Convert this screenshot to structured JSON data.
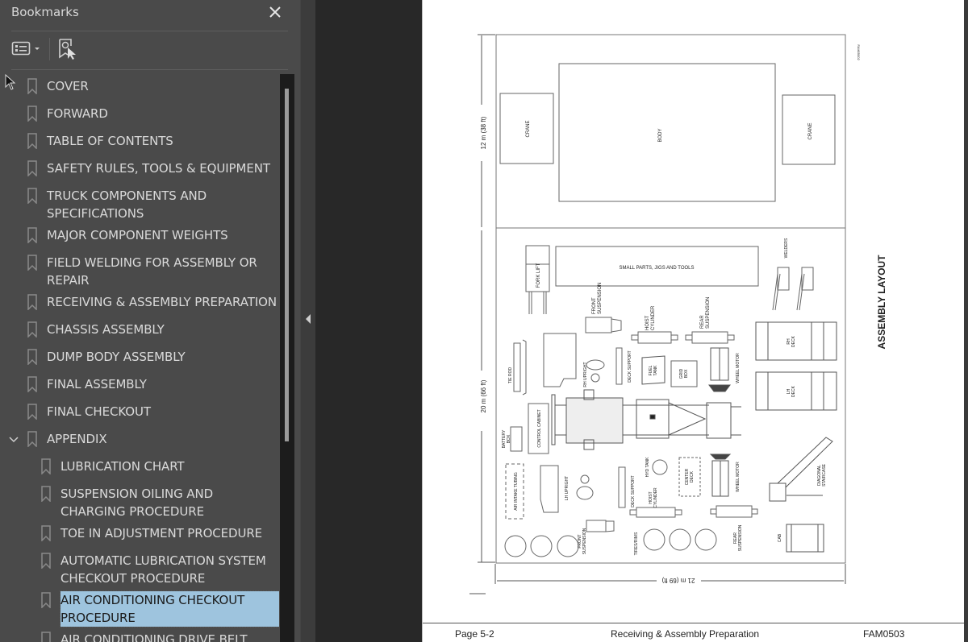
{
  "sidebar": {
    "title": "Bookmarks",
    "close_icon": "close-icon",
    "toolbar": {
      "options_icon": "list-options-icon",
      "options_dropdown_icon": "caret-down-icon",
      "find_bookmark_icon": "bookmark-search-icon"
    },
    "items": [
      {
        "label": "COVER",
        "level": 0
      },
      {
        "label": "FORWARD",
        "level": 0
      },
      {
        "label": "TABLE OF CONTENTS",
        "level": 0
      },
      {
        "label": "SAFETY RULES, TOOLS & EQUIPMENT",
        "level": 0
      },
      {
        "label": "TRUCK COMPONENTS AND SPECIFICATIONS",
        "level": 0
      },
      {
        "label": "MAJOR COMPONENT WEIGHTS",
        "level": 0
      },
      {
        "label": "FIELD WELDING FOR ASSEMBLY OR REPAIR",
        "level": 0
      },
      {
        "label": "RECEIVING & ASSEMBLY PREPARATION",
        "level": 0
      },
      {
        "label": "CHASSIS ASSEMBLY",
        "level": 0
      },
      {
        "label": "DUMP BODY ASSEMBLY",
        "level": 0
      },
      {
        "label": "FINAL ASSEMBLY",
        "level": 0
      },
      {
        "label": "FINAL CHECKOUT",
        "level": 0
      },
      {
        "label": "APPENDIX",
        "level": 0,
        "expanded": true
      },
      {
        "label": "LUBRICATION CHART",
        "level": 1
      },
      {
        "label": "SUSPENSION OILING AND CHARGING PROCEDURE",
        "level": 1
      },
      {
        "label": "TOE IN ADJUSTMENT PROCEDURE",
        "level": 1
      },
      {
        "label": "AUTOMATIC LUBRICATION SYSTEM CHECKOUT PROCEDURE",
        "level": 1
      },
      {
        "label": "AIR CONDITIONING CHECKOUT PROCEDURE",
        "level": 1,
        "selected": true
      },
      {
        "label": "AIR CONDITIONING DRIVE BELT",
        "level": 1
      }
    ],
    "selected_color": "#9ec4de"
  },
  "document": {
    "figure": {
      "title": "ASSEMBLY LAYOUT",
      "figure_id": "FAM05002",
      "dim_top": "12 m (38 ft)",
      "dim_bottom_area": "20 m (66 ft)",
      "dim_width": "21 m (69 ft)",
      "labels": {
        "crane_left": "CRANE",
        "body": "BODY",
        "crane_right": "CRANE",
        "small_parts": "SMALL PARTS, JIGS AND TOOLS",
        "fork_lift": "FORK LIFT",
        "welders": "WELDERS",
        "front_suspension_top": [
          "FRONT",
          "SUSPENSION"
        ],
        "hoist_cylinder_top": [
          "HOIST",
          "CYLINDER"
        ],
        "rear_suspension_top": [
          "REAR",
          "SUSPENSION"
        ],
        "rh_deck": [
          "RH",
          "DECK"
        ],
        "lh_deck": [
          "LH",
          "DECK"
        ],
        "tie_rod": "TIE ROD",
        "rh_upright": "RH UPRIGHT",
        "deck_support_top": "DECK SUPPORT",
        "fuel_tank": [
          "FUEL",
          "TANK"
        ],
        "grid_box": [
          "GRID",
          "BOX"
        ],
        "wheel_motor_top": "WHEEL MOTOR",
        "battery_box": [
          "BATTERY",
          "BOX"
        ],
        "control_cabinet": "CONTROL CABINET",
        "air_intake_tubing": "AIR INTAKE TUBING",
        "lh_upright": "LH UPRIGHT",
        "deck_support_bottom": "DECK SUPPORT",
        "hyd_tank": "HYD TANK",
        "hoist_cylinder_bottom": [
          "HOIST",
          "CYLINDER"
        ],
        "center_deck": [
          "CENTER",
          "DECK"
        ],
        "wheel_motor_bottom": "WHEEL MOTOR",
        "diagonal_staircase": [
          "DIAGONAL",
          "STAIRCASE"
        ],
        "front_suspension_bottom": [
          "FRONT",
          "SUSPENSION"
        ],
        "tires_rims": "TIRES/RIMS",
        "rear_suspension_bottom": [
          "REAR",
          "SUSPENSION"
        ],
        "cab": "CAB"
      }
    },
    "footer": {
      "page": "Page 5-2",
      "section": "Receiving & Assembly Preparation",
      "code": "FAM0503"
    }
  },
  "splitter": {
    "collapse_icon": "triangle-left-icon"
  }
}
